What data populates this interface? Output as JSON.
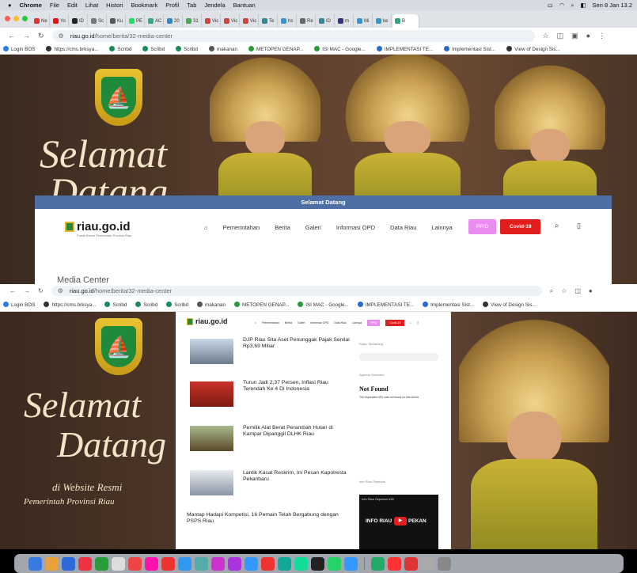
{
  "menubar": {
    "items": [
      "Chrome",
      "File",
      "Edit",
      "Lihat",
      "Histori",
      "Bookmark",
      "Profil",
      "Tab",
      "Jendela",
      "Bantuan"
    ],
    "clock": "Sen 8 Jan 13.2"
  },
  "tabs": [
    "Ne",
    "Yo",
    "ID",
    "Sc",
    "Ku",
    "PE",
    "AC",
    "20",
    "31",
    "Vic",
    "Vic",
    "Vic",
    "Te",
    "hs",
    "Re",
    "ID",
    "m",
    "Mi",
    "ke",
    "B"
  ],
  "browser": {
    "url_host": "riau.go.id",
    "url_path": "/home/berita/32-media-center"
  },
  "bookmarks": [
    "Login BOS",
    "https://cms.brksya...",
    "Scribd",
    "Scribd",
    "Scribd",
    "makanan",
    "METOPEN GENAP...",
    "ISI MAC - Google...",
    "IMPLEMENTASI TE...",
    "Implementasi Sist...",
    "View of Design Sis..."
  ],
  "hero": {
    "greeting_1": "Selamat",
    "greeting_2": "Datang",
    "tagline_1": "di Website Resmi",
    "tagline_2": "Pemerintah Provinsi Riau"
  },
  "site": {
    "banner": "Selamat Datang",
    "logo": "riau.go.id",
    "logo_sub": "Portal Resmi Pemerintah Provinsi Riau",
    "nav": [
      "Pemerintahan",
      "Berita",
      "Galeri",
      "Informasi OPD",
      "Data Riau",
      "Lainnya"
    ],
    "ppid": "PPID",
    "covid": "Covid-19",
    "section": "Media Center"
  },
  "articles": [
    {
      "title": "DJP Riau Sita Aset Penunggak Pajak Senilai Rp3,69 Miliar"
    },
    {
      "title": "Turun Jadi 2,37 Persen, Inflasi Riau Terendah Ke 4 Di Indonesia"
    },
    {
      "title": "Pemilik Alat Berat Perambah Hutan di Kampar Dipanggil DLHK Riau"
    },
    {
      "title": "Lantik Kasat Reskrim, Ini Pesan Kapolresta Pekanbaru"
    },
    {
      "title": "Mantap Hadapi Kompetisi, 16 Pemain Telah Bergabung dengan PSPS Riau"
    }
  ],
  "sidebar": {
    "radio_label": "Radio Streaming",
    "agenda_label": "Agenda Gubernur",
    "not_found": "Not Found",
    "not_found_msg": "The requested URL was not found on this server.",
    "video_label": "Info Riau Sepekan",
    "video_title": "Info Riau Sepekan #35",
    "video_caption_left": "INFO RIAU",
    "video_caption_right": "PEKAN"
  },
  "colors": {
    "navtop": "#4e6fa3",
    "covid": "#e11d1d",
    "ppid": "#e98ef0"
  }
}
